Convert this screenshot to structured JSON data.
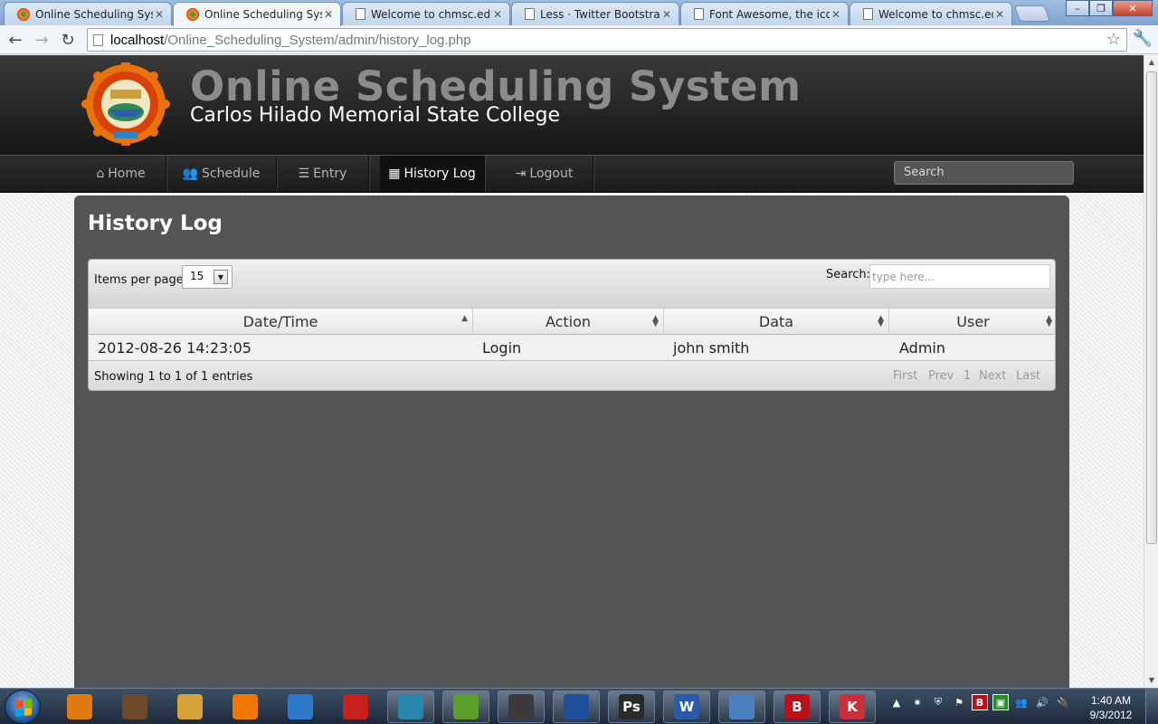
{
  "browser": {
    "tabs": [
      {
        "title": "Online Scheduling System",
        "favicon": "college-seal-icon",
        "active": false
      },
      {
        "title": "Online Scheduling System",
        "favicon": "college-seal-icon",
        "active": true
      },
      {
        "title": "Welcome to chmsc.edu.ph",
        "favicon": "page-icon",
        "active": false
      },
      {
        "title": "Less · Twitter Bootstrap",
        "favicon": "page-icon",
        "active": false
      },
      {
        "title": "Font Awesome, the iconic font",
        "favicon": "page-icon",
        "active": false
      },
      {
        "title": "Welcome to chmsc.edu.ph",
        "favicon": "page-icon",
        "active": false
      }
    ],
    "address": {
      "host": "localhost",
      "path": "/Online_Scheduling_System/admin/history_log.php"
    },
    "window_controls": {
      "minimize": "–",
      "restore": "❐",
      "close": "✕"
    }
  },
  "site": {
    "title": "Online Scheduling System",
    "subtitle": "Carlos Hilado Memorial State College"
  },
  "nav": {
    "items": [
      {
        "label": "Home",
        "icon": "home-icon",
        "glyph": "⌂",
        "active": false
      },
      {
        "label": "Schedule",
        "icon": "group-icon",
        "glyph": "👥",
        "active": false
      },
      {
        "label": "Entry",
        "icon": "list-icon",
        "glyph": "☰",
        "active": false
      },
      {
        "label": "History Log",
        "icon": "table-icon",
        "glyph": "▦",
        "active": true
      },
      {
        "label": "Logout",
        "icon": "logout-icon",
        "glyph": "⇥",
        "active": false
      }
    ],
    "search_placeholder": "Search"
  },
  "page": {
    "heading": "History Log",
    "table": {
      "length_label": "Items per page:",
      "length_value": "15",
      "search_label": "Search:",
      "search_placeholder": "type here...",
      "columns": [
        "Date/Time",
        "Action",
        "Data",
        "User"
      ],
      "rows": [
        [
          "2012-08-26 14:23:05",
          "Login",
          "john smith",
          "Admin"
        ]
      ],
      "info": "Showing 1 to 1 of 1 entries",
      "pagination": {
        "first": "First",
        "prev": "Prev",
        "page": "1",
        "next": "Next",
        "last": "Last"
      }
    }
  },
  "taskbar": {
    "clock_time": "1:40 AM",
    "clock_date": "9/3/2012",
    "apps": [
      {
        "name": "mobile-app-icon",
        "letter": "",
        "color": "#e07a12"
      },
      {
        "name": "media-player-icon",
        "letter": "",
        "color": "#6a4a2a"
      },
      {
        "name": "paint-icon",
        "letter": "",
        "color": "#d6a23a"
      },
      {
        "name": "vlc-icon",
        "letter": "",
        "color": "#f07800"
      },
      {
        "name": "storage-icon",
        "letter": "",
        "color": "#2d78c8"
      },
      {
        "name": "flash-icon",
        "letter": "",
        "color": "#c8201a"
      },
      {
        "name": "speech-icon",
        "letter": "",
        "color": "#2a88b0"
      },
      {
        "name": "editor-icon",
        "letter": "",
        "color": "#5aa02a"
      },
      {
        "name": "windows-app-icon",
        "letter": "",
        "color": "#3a3a3a"
      },
      {
        "name": "browser-globe-icon",
        "letter": "",
        "color": "#1f4f9a"
      },
      {
        "name": "photoshop-icon",
        "letter": "Ps",
        "color": "#2a2a2a"
      },
      {
        "name": "word-icon",
        "letter": "W",
        "color": "#2a5aa8"
      },
      {
        "name": "control-panel-icon",
        "letter": "",
        "color": "#4a80c0"
      },
      {
        "name": "bitdefender-icon",
        "letter": "B",
        "color": "#b8121a"
      },
      {
        "name": "kaspersky-icon",
        "letter": "K",
        "color": "#c8303a"
      }
    ]
  },
  "colors": {
    "header_bg": "#1f1f1f",
    "title_gray": "#8c8c8c",
    "panel_bg": "#555555",
    "nav_active": "#111111"
  }
}
